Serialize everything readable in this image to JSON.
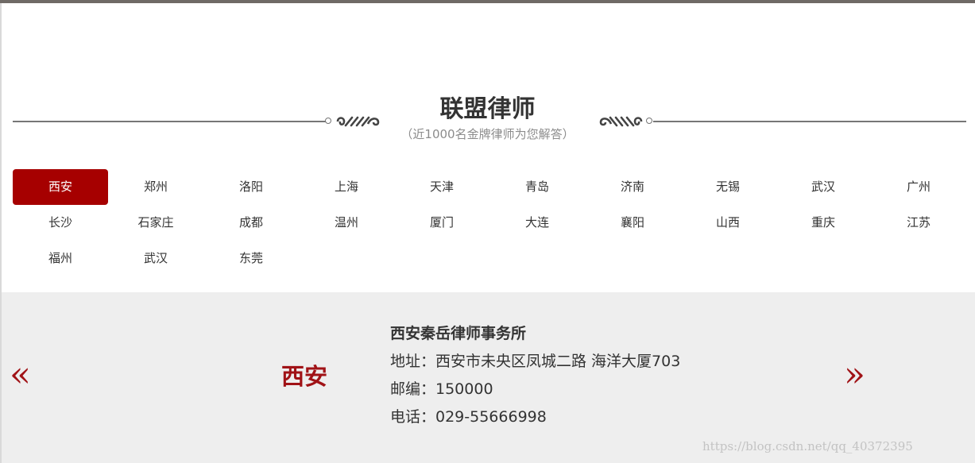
{
  "heading": {
    "title": "联盟律师",
    "subtitle": "（近1000名金牌律师为您解答）"
  },
  "cities": [
    {
      "label": "西安",
      "active": true
    },
    {
      "label": "郑州"
    },
    {
      "label": "洛阳"
    },
    {
      "label": "上海"
    },
    {
      "label": "天津"
    },
    {
      "label": "青岛"
    },
    {
      "label": "济南"
    },
    {
      "label": "无锡"
    },
    {
      "label": "武汉"
    },
    {
      "label": "广州"
    },
    {
      "label": "长沙"
    },
    {
      "label": "石家庄"
    },
    {
      "label": "成都"
    },
    {
      "label": "温州"
    },
    {
      "label": "厦门"
    },
    {
      "label": "大连"
    },
    {
      "label": "襄阳"
    },
    {
      "label": "山西"
    },
    {
      "label": "重庆"
    },
    {
      "label": "江苏"
    },
    {
      "label": "福州"
    },
    {
      "label": "武汉"
    },
    {
      "label": "东莞"
    }
  ],
  "firm": {
    "city": "西安",
    "name": "西安秦岳律师事务所",
    "address": "地址：西安市未央区凤城二路 海洋大厦703",
    "postcode": "邮编：150000",
    "phone": "电话：029-55666998"
  },
  "nav": {
    "prev_glyph": "«",
    "next_glyph": "»"
  },
  "watermark": "https://blog.csdn.net/qq_40372395",
  "colors": {
    "accent": "#a60000",
    "arrow": "#a01216",
    "panel_bg": "#eeeeee"
  }
}
